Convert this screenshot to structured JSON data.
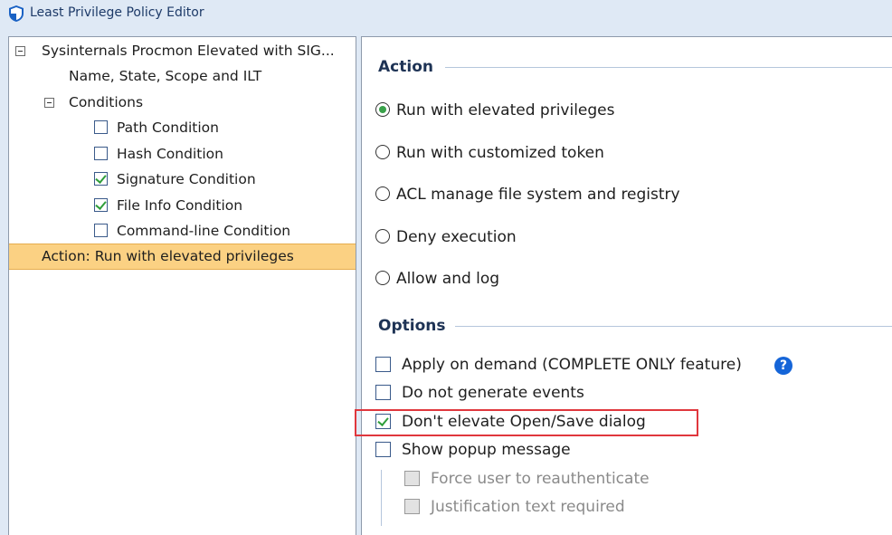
{
  "window": {
    "title": "Least Privilege Policy Editor",
    "icon": "shield-icon"
  },
  "tree": {
    "root": {
      "label": "Sysinternals Procmon Elevated with SIG...",
      "expanded": true
    },
    "name_state": {
      "label": "Name, State, Scope and ILT"
    },
    "conditions": {
      "label": "Conditions",
      "expanded": true,
      "items": [
        {
          "label": "Path Condition",
          "checked": false
        },
        {
          "label": "Hash Condition",
          "checked": false
        },
        {
          "label": "Signature Condition",
          "checked": true
        },
        {
          "label": "File Info Condition",
          "checked": true
        },
        {
          "label": "Command-line Condition",
          "checked": false
        }
      ]
    },
    "action": {
      "label": "Action: Run with elevated privileges",
      "selected": true
    }
  },
  "action_group": {
    "header": "Action",
    "options": [
      {
        "label": "Run with elevated privileges",
        "selected": true
      },
      {
        "label": "Run with customized token",
        "selected": false
      },
      {
        "label": "ACL manage file system and registry",
        "selected": false
      },
      {
        "label": "Deny execution",
        "selected": false
      },
      {
        "label": "Allow and log",
        "selected": false
      }
    ]
  },
  "options_group": {
    "header": "Options",
    "apply_on_demand": {
      "label": "Apply on demand (COMPLETE ONLY feature)",
      "checked": false,
      "help_icon": "question-mark-icon",
      "help_glyph": "?"
    },
    "no_events": {
      "label": "Do not generate events",
      "checked": false
    },
    "dont_elevate_dialog": {
      "label": "Don't elevate Open/Save dialog",
      "checked": true,
      "highlighted": true
    },
    "show_popup": {
      "label": "Show popup message",
      "checked": false
    },
    "force_reauth": {
      "label": "Force user to reauthenticate",
      "checked": false,
      "enabled": false
    },
    "justification": {
      "label": "Justification text required",
      "checked": false,
      "enabled": false
    }
  },
  "colors": {
    "selection": "#fbd183",
    "check": "#2f9e3a",
    "radio_dot": "#39a14a",
    "help": "#1565d8",
    "highlight": "#e0373d"
  }
}
